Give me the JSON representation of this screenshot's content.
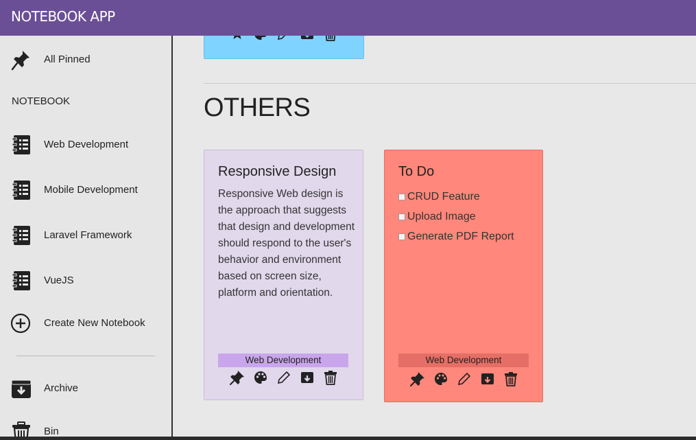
{
  "app": {
    "title": "NOTEBOOK APP"
  },
  "sidebar": {
    "pinned": {
      "label": "All Pinned",
      "icon": "pin-icon"
    },
    "section_label": "NOTEBOOK",
    "notebooks": [
      {
        "label": "Web Development",
        "icon": "notebook-icon"
      },
      {
        "label": "Mobile Development",
        "icon": "notebook-icon"
      },
      {
        "label": "Laravel Framework",
        "icon": "notebook-icon"
      },
      {
        "label": "VueJS",
        "icon": "notebook-icon"
      }
    ],
    "create": {
      "label": "Create New Notebook",
      "icon": "plus-circle-icon"
    },
    "archive": {
      "label": "Archive",
      "icon": "archive-icon"
    },
    "bin": {
      "label": "Bin",
      "icon": "trash-icon"
    }
  },
  "main": {
    "others_heading": "OTHERS",
    "notes": [
      {
        "title": "Responsive Design",
        "body": "Responsive Web design is the approach that suggests that design and development should respond to the user's behavior and environment based on screen size, platform and orientation.",
        "tag": "Web Development",
        "color": "#e1d8ec",
        "tag_color": "#c9a6ec"
      },
      {
        "title": "To Do",
        "todos": [
          "CRUD Feature",
          "Upload Image",
          "Generate PDF Report"
        ],
        "tag": "Web Development",
        "color": "#ff877b",
        "tag_color": "#e56f66"
      }
    ],
    "pinned_stub_color": "#7fd3ff"
  },
  "colors": {
    "appbar": "#6b4f96",
    "background": "#e8e8e8"
  }
}
